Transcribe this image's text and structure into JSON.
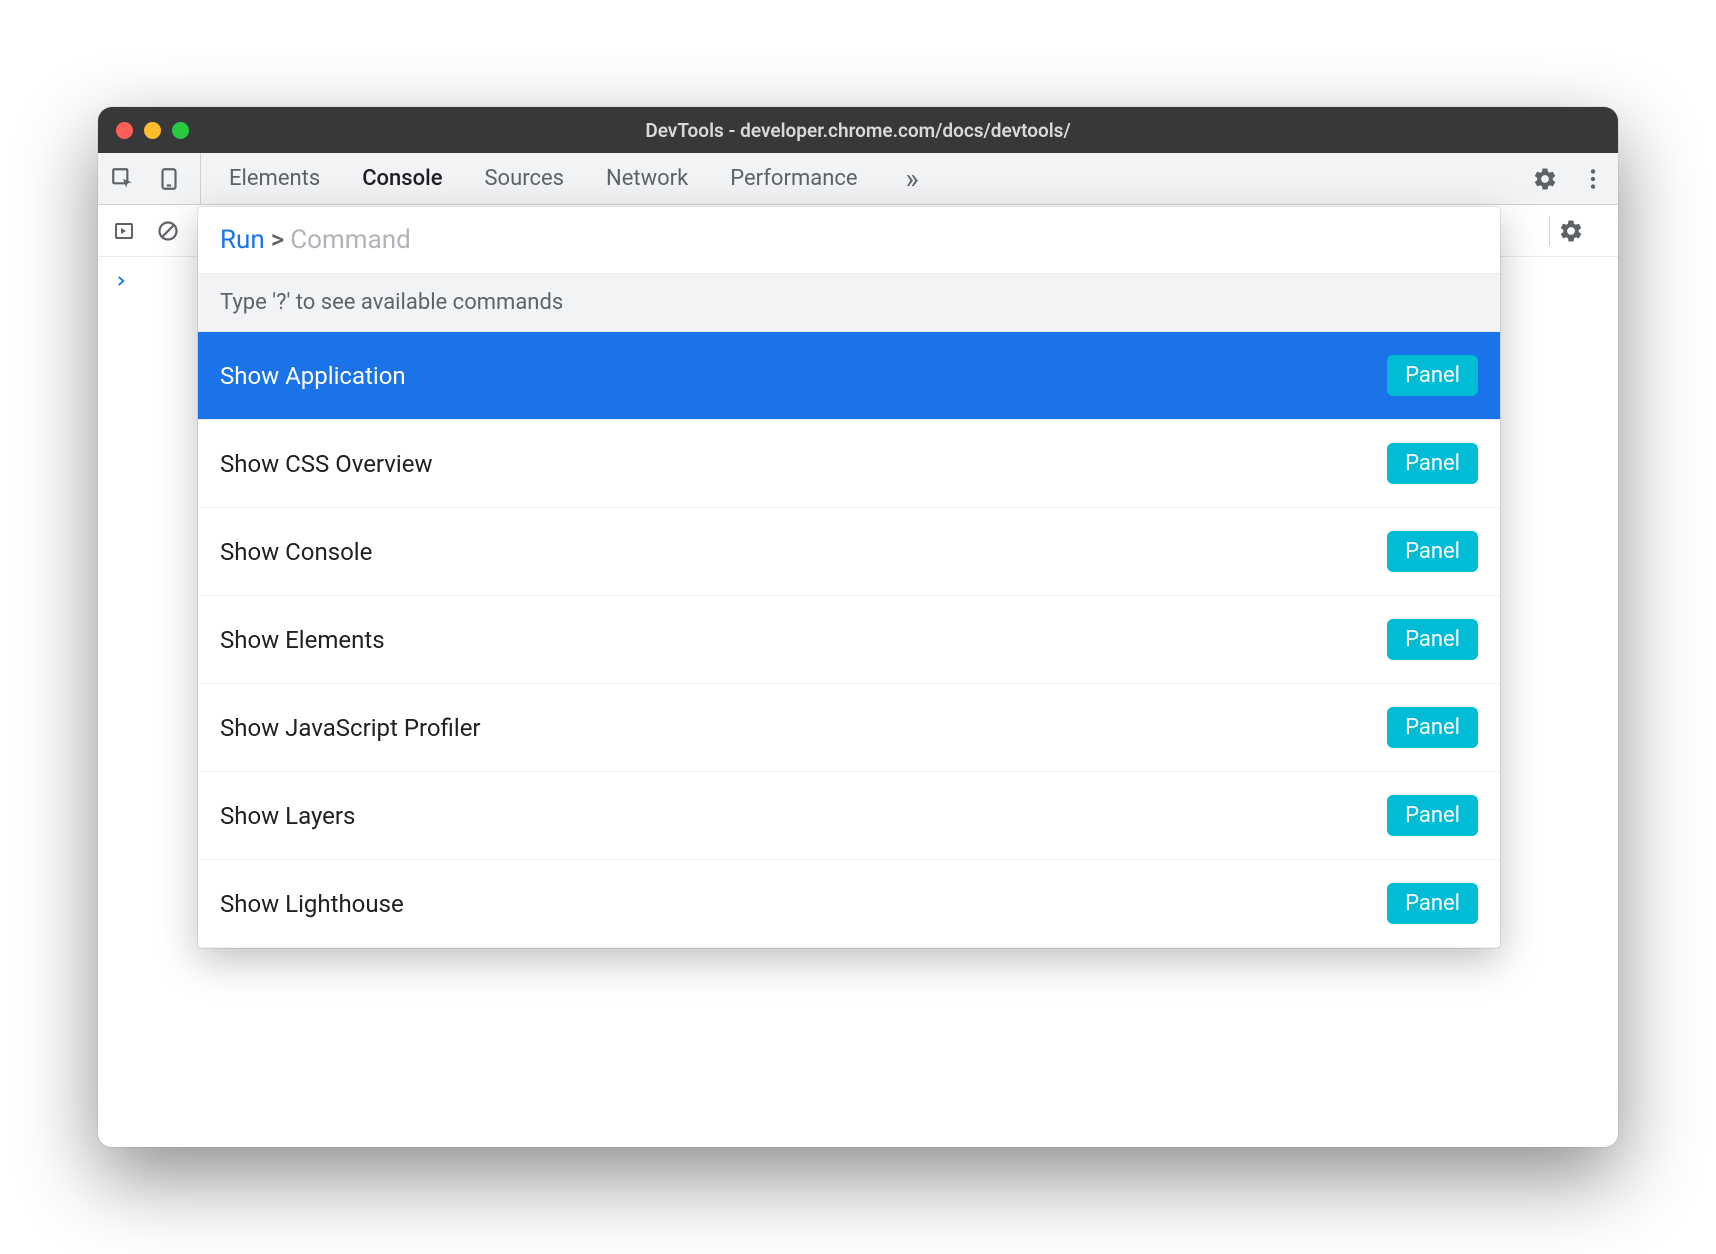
{
  "window": {
    "title": "DevTools - developer.chrome.com/docs/devtools/"
  },
  "tabs": {
    "items": [
      "Elements",
      "Console",
      "Sources",
      "Network",
      "Performance"
    ],
    "active_index": 1,
    "overflow_glyph": "»"
  },
  "command_menu": {
    "run_label": "Run",
    "separator": ">",
    "placeholder": "Command",
    "hint": "Type '?' to see available commands",
    "badge_label": "Panel",
    "selected_index": 0,
    "items": [
      {
        "label": "Show Application",
        "badge": "Panel"
      },
      {
        "label": "Show CSS Overview",
        "badge": "Panel"
      },
      {
        "label": "Show Console",
        "badge": "Panel"
      },
      {
        "label": "Show Elements",
        "badge": "Panel"
      },
      {
        "label": "Show JavaScript Profiler",
        "badge": "Panel"
      },
      {
        "label": "Show Layers",
        "badge": "Panel"
      },
      {
        "label": "Show Lighthouse",
        "badge": "Panel"
      }
    ]
  },
  "console": {
    "prompt": ">"
  }
}
